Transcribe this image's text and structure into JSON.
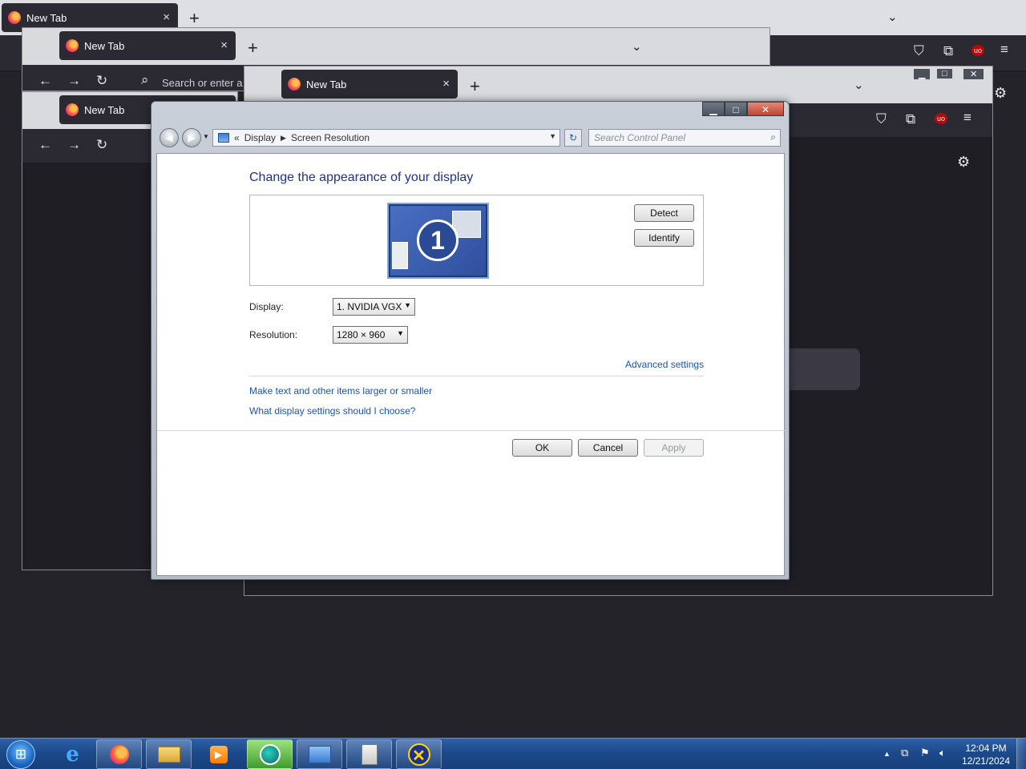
{
  "browser": {
    "tab_title": "New Tab",
    "tab_close": "×",
    "new_tab": "+",
    "tab_list": "⌄",
    "url_placeholder": "Search or enter address",
    "url_visible": "Search or enter a",
    "back": "←",
    "forward": "→",
    "reload": "↻",
    "search_glyph": "⌕",
    "pocket": "⛉",
    "extensions": "⧉",
    "ublock": "uo",
    "menu": "≡",
    "settings": "⚙"
  },
  "dialog": {
    "breadcrumb": [
      "Display",
      "Screen Resolution"
    ],
    "breadcrumb_prefix": "«",
    "search_placeholder": "Search Control Panel",
    "heading": "Change the appearance of your display",
    "monitor_number": "1",
    "detect_label": "Detect",
    "identify_label": "Identify",
    "display_label": "Display:",
    "display_value": "1. NVIDIA VGX",
    "resolution_label": "Resolution:",
    "resolution_value": "1280 × 960",
    "advanced_link": "Advanced settings",
    "link_text_size": "Make text and other items larger or smaller",
    "link_which_settings": "What display settings should I choose?",
    "ok_label": "OK",
    "cancel_label": "Cancel",
    "apply_label": "Apply"
  },
  "taskbar": {
    "start": "⊞",
    "apps": [
      "internet-explorer",
      "firefox",
      "file-explorer",
      "media-player",
      "app-green",
      "control-panel",
      "notes",
      "x-app"
    ],
    "clock_time": "12:04 PM",
    "clock_date": "12/21/2024"
  }
}
